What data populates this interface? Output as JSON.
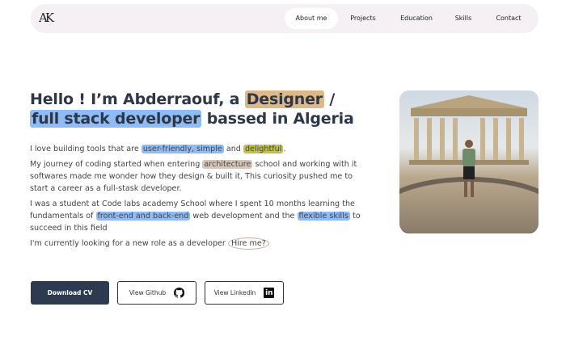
{
  "nav": {
    "logo": "AK",
    "items": [
      {
        "label": "About me",
        "active": true
      },
      {
        "label": "Projects"
      },
      {
        "label": "Education"
      },
      {
        "label": "Skills"
      },
      {
        "label": "Contact"
      }
    ]
  },
  "hero": {
    "h1": {
      "p1": "Hello ! I’m Abderraouf, a ",
      "designer": "Designer",
      "p2": " /",
      "fullstack": "full stack developer",
      "p3": " bassed in Algeria"
    },
    "para1": {
      "a": "I love building tools that are ",
      "h1": "user-friendly, simple",
      "b": " and ",
      "h2": "delightful",
      "c": "."
    },
    "para2": {
      "a": "My journey of coding started when entering ",
      "h1": "architecture",
      "b": " school and working with it softwares made me wonder how they design & built it, This curiosity pushed me to start a career as a full-stask developer."
    },
    "para3": {
      "a": "I was a student at Code labs academy School where I spent 10 months learning the fundamentals of ",
      "h1": "front-end and back-end",
      "b": " web development and the ",
      "h2": "flexible skills",
      "c": " to succeed in this field"
    },
    "para4": {
      "a": "I'm currently looking for a new role as a developer ",
      "h1": "Hire me?"
    }
  },
  "buttons": {
    "download": "Download CV",
    "github": "View Github",
    "linkedin": "View LinkedIn",
    "linkedin_glyph": "in"
  }
}
